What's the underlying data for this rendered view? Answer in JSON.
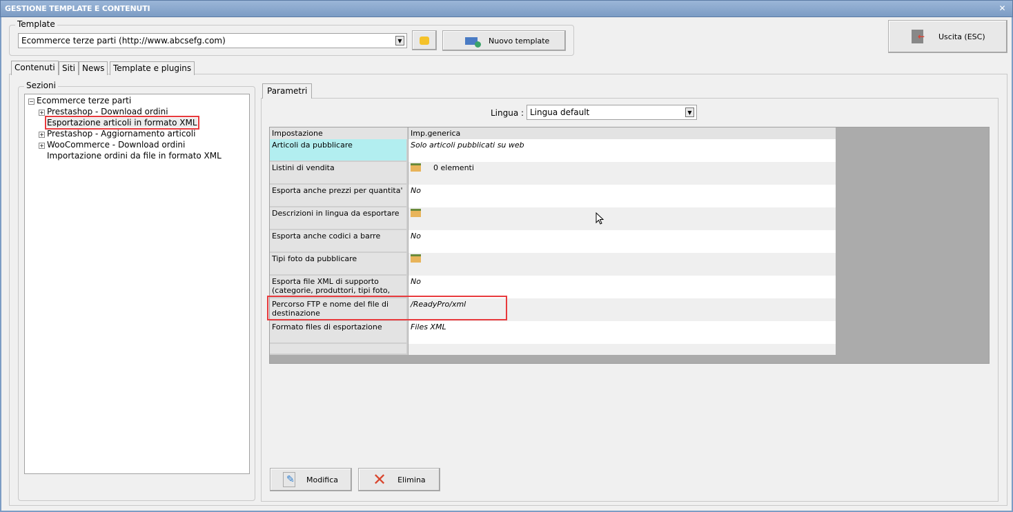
{
  "window": {
    "title": "GESTIONE TEMPLATE E CONTENUTI",
    "close_icon": "close-icon"
  },
  "template": {
    "group_label": "Template",
    "selected": "Ecommerce terze parti (http://www.abcsefg.com)",
    "new_label": "Nuovo template"
  },
  "exit": {
    "label": "Uscita (ESC)"
  },
  "tabs": [
    "Contenuti",
    "Siti",
    "News",
    "Template e plugins"
  ],
  "sections": {
    "label": "Sezioni",
    "root": "Ecommerce terze parti",
    "items": [
      {
        "label": "Prestashop - Download ordini",
        "expandable": true
      },
      {
        "label": "Esportazione articoli in formato XML",
        "expandable": false,
        "selected": true
      },
      {
        "label": "Prestashop - Aggiornamento articoli",
        "expandable": true
      },
      {
        "label": "WooCommerce - Download ordini",
        "expandable": true
      },
      {
        "label": "Importazione ordini da file in formato XML",
        "expandable": false
      }
    ]
  },
  "params": {
    "tab": "Parametri",
    "lingua_label": "Lingua :",
    "lingua_value": "Lingua default",
    "headers": [
      "Impostazione",
      "Imp.generica"
    ],
    "rows": [
      {
        "label": "Articoli da pubblicare",
        "value": "Solo articoli pubblicati su web",
        "selected": true
      },
      {
        "label": "Listini di vendita",
        "value": "0 elementi",
        "folder": true
      },
      {
        "label": "Esporta anche prezzi per quantita'",
        "value": "No"
      },
      {
        "label": "Descrizioni in lingua da esportare",
        "value": "",
        "folder": true
      },
      {
        "label": "Esporta anche codici a barre",
        "value": "No"
      },
      {
        "label": "Tipi foto da pubblicare",
        "value": "",
        "folder": true
      },
      {
        "label": "Esporta file XML di supporto (categorie, produttori, tipi foto, tipi di listino)",
        "value": "No"
      },
      {
        "label": "Percorso FTP e nome del file di destinazione",
        "value": "/ReadyPro/xml",
        "highlighted": true
      },
      {
        "label": "Formato files di esportazione",
        "value": "Files XML"
      },
      {
        "label": "",
        "value": ""
      }
    ]
  },
  "actions": {
    "edit": "Modifica",
    "delete": "Elimina"
  },
  "colors": {
    "selected_cell": "#b2eef0",
    "highlight": "#e8393c",
    "title_bar": "#7c9cc4"
  }
}
